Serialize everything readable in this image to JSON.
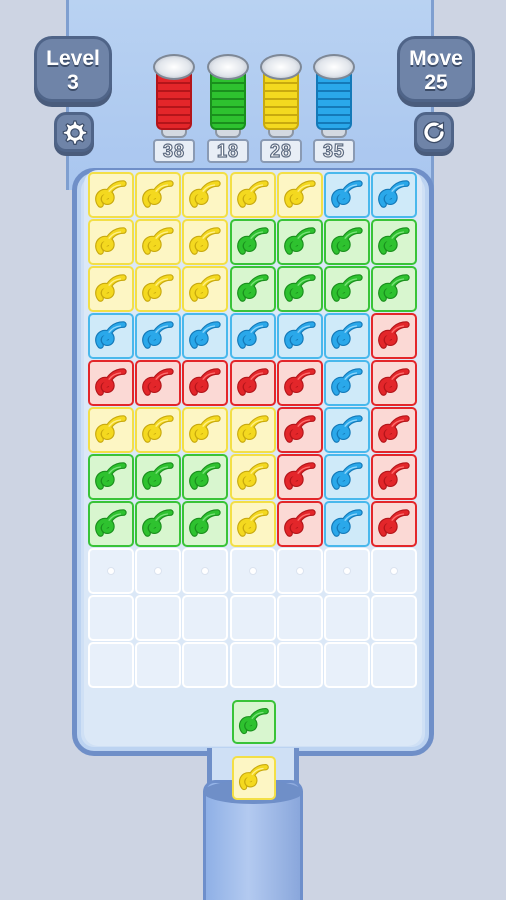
{
  "hud": {
    "level_label": "Level",
    "level_value": "3",
    "move_label": "Move",
    "move_value": "25"
  },
  "spools": [
    {
      "color": "red",
      "count": "38"
    },
    {
      "color": "green",
      "count": "18"
    },
    {
      "color": "yellow",
      "count": "28"
    },
    {
      "color": "blue",
      "count": "35"
    }
  ],
  "colors": {
    "red": "#e3262a",
    "green": "#2ec22f",
    "yellow": "#f4d91f",
    "blue": "#2aa8ea",
    "hud": "#6f84a8",
    "tray_border": "#6f8fc8"
  },
  "icons": {
    "settings": "gear-icon",
    "restart": "restart-icon",
    "yarn": "yarn-coil-icon"
  },
  "grid": {
    "rows": [
      [
        "yellow",
        "yellow",
        "yellow",
        "yellow",
        "yellow",
        "blue",
        "blue"
      ],
      [
        "yellow",
        "yellow",
        "yellow",
        "green",
        "green",
        "green",
        "green"
      ],
      [
        "yellow",
        "yellow",
        "yellow",
        "green",
        "green",
        "green",
        "green"
      ],
      [
        "blue",
        "blue",
        "blue",
        "blue",
        "blue",
        "blue",
        "red"
      ],
      [
        "red",
        "red",
        "red",
        "red",
        "red",
        "blue",
        "red"
      ],
      [
        "yellow",
        "yellow",
        "yellow",
        "yellow",
        "red",
        "blue",
        "red"
      ],
      [
        "green",
        "green",
        "green",
        "yellow",
        "red",
        "blue",
        "red"
      ],
      [
        "green",
        "green",
        "green",
        "yellow",
        "red",
        "blue",
        "red"
      ],
      [
        "dot",
        "dot",
        "dot",
        "dot",
        "dot",
        "dot",
        "dot"
      ],
      [
        "empty",
        "empty",
        "empty",
        "empty",
        "empty",
        "empty",
        "empty"
      ],
      [
        "empty",
        "empty",
        "empty",
        "empty",
        "empty",
        "empty",
        "empty"
      ]
    ]
  },
  "queue": [
    "green",
    "yellow"
  ]
}
